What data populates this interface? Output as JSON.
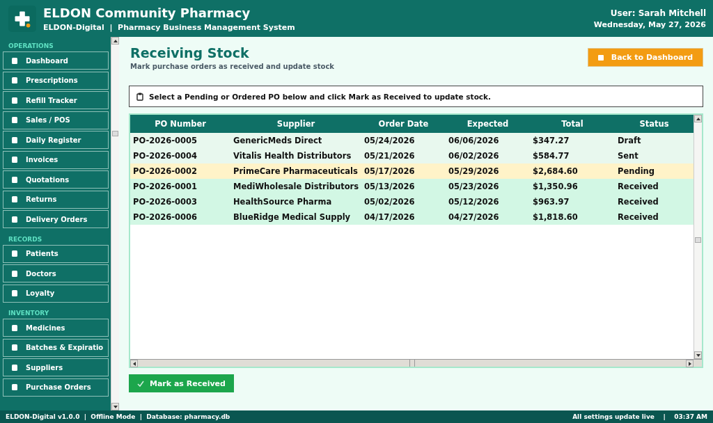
{
  "header": {
    "title": "ELDON Community Pharmacy",
    "subtitle": "ELDON-Digital  |  Pharmacy Business Management System",
    "user": "User: Sarah Mitchell",
    "date": "Wednesday, May 27, 2026"
  },
  "sidebar": {
    "sections": [
      {
        "label": "OPERATIONS",
        "items": [
          {
            "label": "Dashboard"
          },
          {
            "label": "Prescriptions"
          },
          {
            "label": "Refill Tracker"
          },
          {
            "label": "Sales / POS"
          },
          {
            "label": "Daily Register"
          },
          {
            "label": "Invoices"
          },
          {
            "label": "Quotations"
          },
          {
            "label": "Returns"
          },
          {
            "label": "Delivery Orders"
          }
        ]
      },
      {
        "label": "RECORDS",
        "items": [
          {
            "label": "Patients"
          },
          {
            "label": "Doctors"
          },
          {
            "label": "Loyalty"
          }
        ]
      },
      {
        "label": "INVENTORY",
        "items": [
          {
            "label": "Medicines"
          },
          {
            "label": "Batches & Expiratio"
          },
          {
            "label": "Suppliers"
          },
          {
            "label": "Purchase Orders"
          }
        ]
      }
    ]
  },
  "page": {
    "title": "Receiving Stock",
    "subtitle": "Mark purchase orders as received and update stock",
    "back_button": "Back to Dashboard",
    "instruction": "Select a Pending or Ordered PO below and click Mark as Received to update stock."
  },
  "table": {
    "columns": [
      "PO Number",
      "Supplier",
      "Order Date",
      "Expected",
      "Total",
      "Status"
    ],
    "rows": [
      {
        "cells": [
          "PO-2026-0005",
          "GenericMeds Direct",
          "05/24/2026",
          "06/06/2026",
          "$347.27",
          "Draft"
        ],
        "color": "#e8f8ee"
      },
      {
        "cells": [
          "PO-2026-0004",
          "Vitalis Health Distributors",
          "05/21/2026",
          "06/02/2026",
          "$584.77",
          "Sent"
        ],
        "color": "#e8f8ee"
      },
      {
        "cells": [
          "PO-2026-0002",
          "PrimeCare Pharmaceuticals",
          "05/17/2026",
          "05/29/2026",
          "$2,684.60",
          "Pending"
        ],
        "color": "#fff3c8"
      },
      {
        "cells": [
          "PO-2026-0001",
          "MediWholesale Distributors",
          "05/13/2026",
          "05/23/2026",
          "$1,350.96",
          "Received"
        ],
        "color": "#d2f7e4"
      },
      {
        "cells": [
          "PO-2026-0003",
          "HealthSource Pharma",
          "05/02/2026",
          "05/12/2026",
          "$963.97",
          "Received"
        ],
        "color": "#d2f7e4"
      },
      {
        "cells": [
          "PO-2026-0006",
          "BlueRidge Medical Supply",
          "04/17/2026",
          "04/27/2026",
          "$1,818.60",
          "Received"
        ],
        "color": "#d2f7e4"
      }
    ]
  },
  "mark_button": "Mark as Received",
  "status_bar": {
    "left": "ELDON-Digital v1.0.0  |  Offline Mode  |  Database: pharmacy.db",
    "right": "All settings update live    |    03:37 AM"
  }
}
